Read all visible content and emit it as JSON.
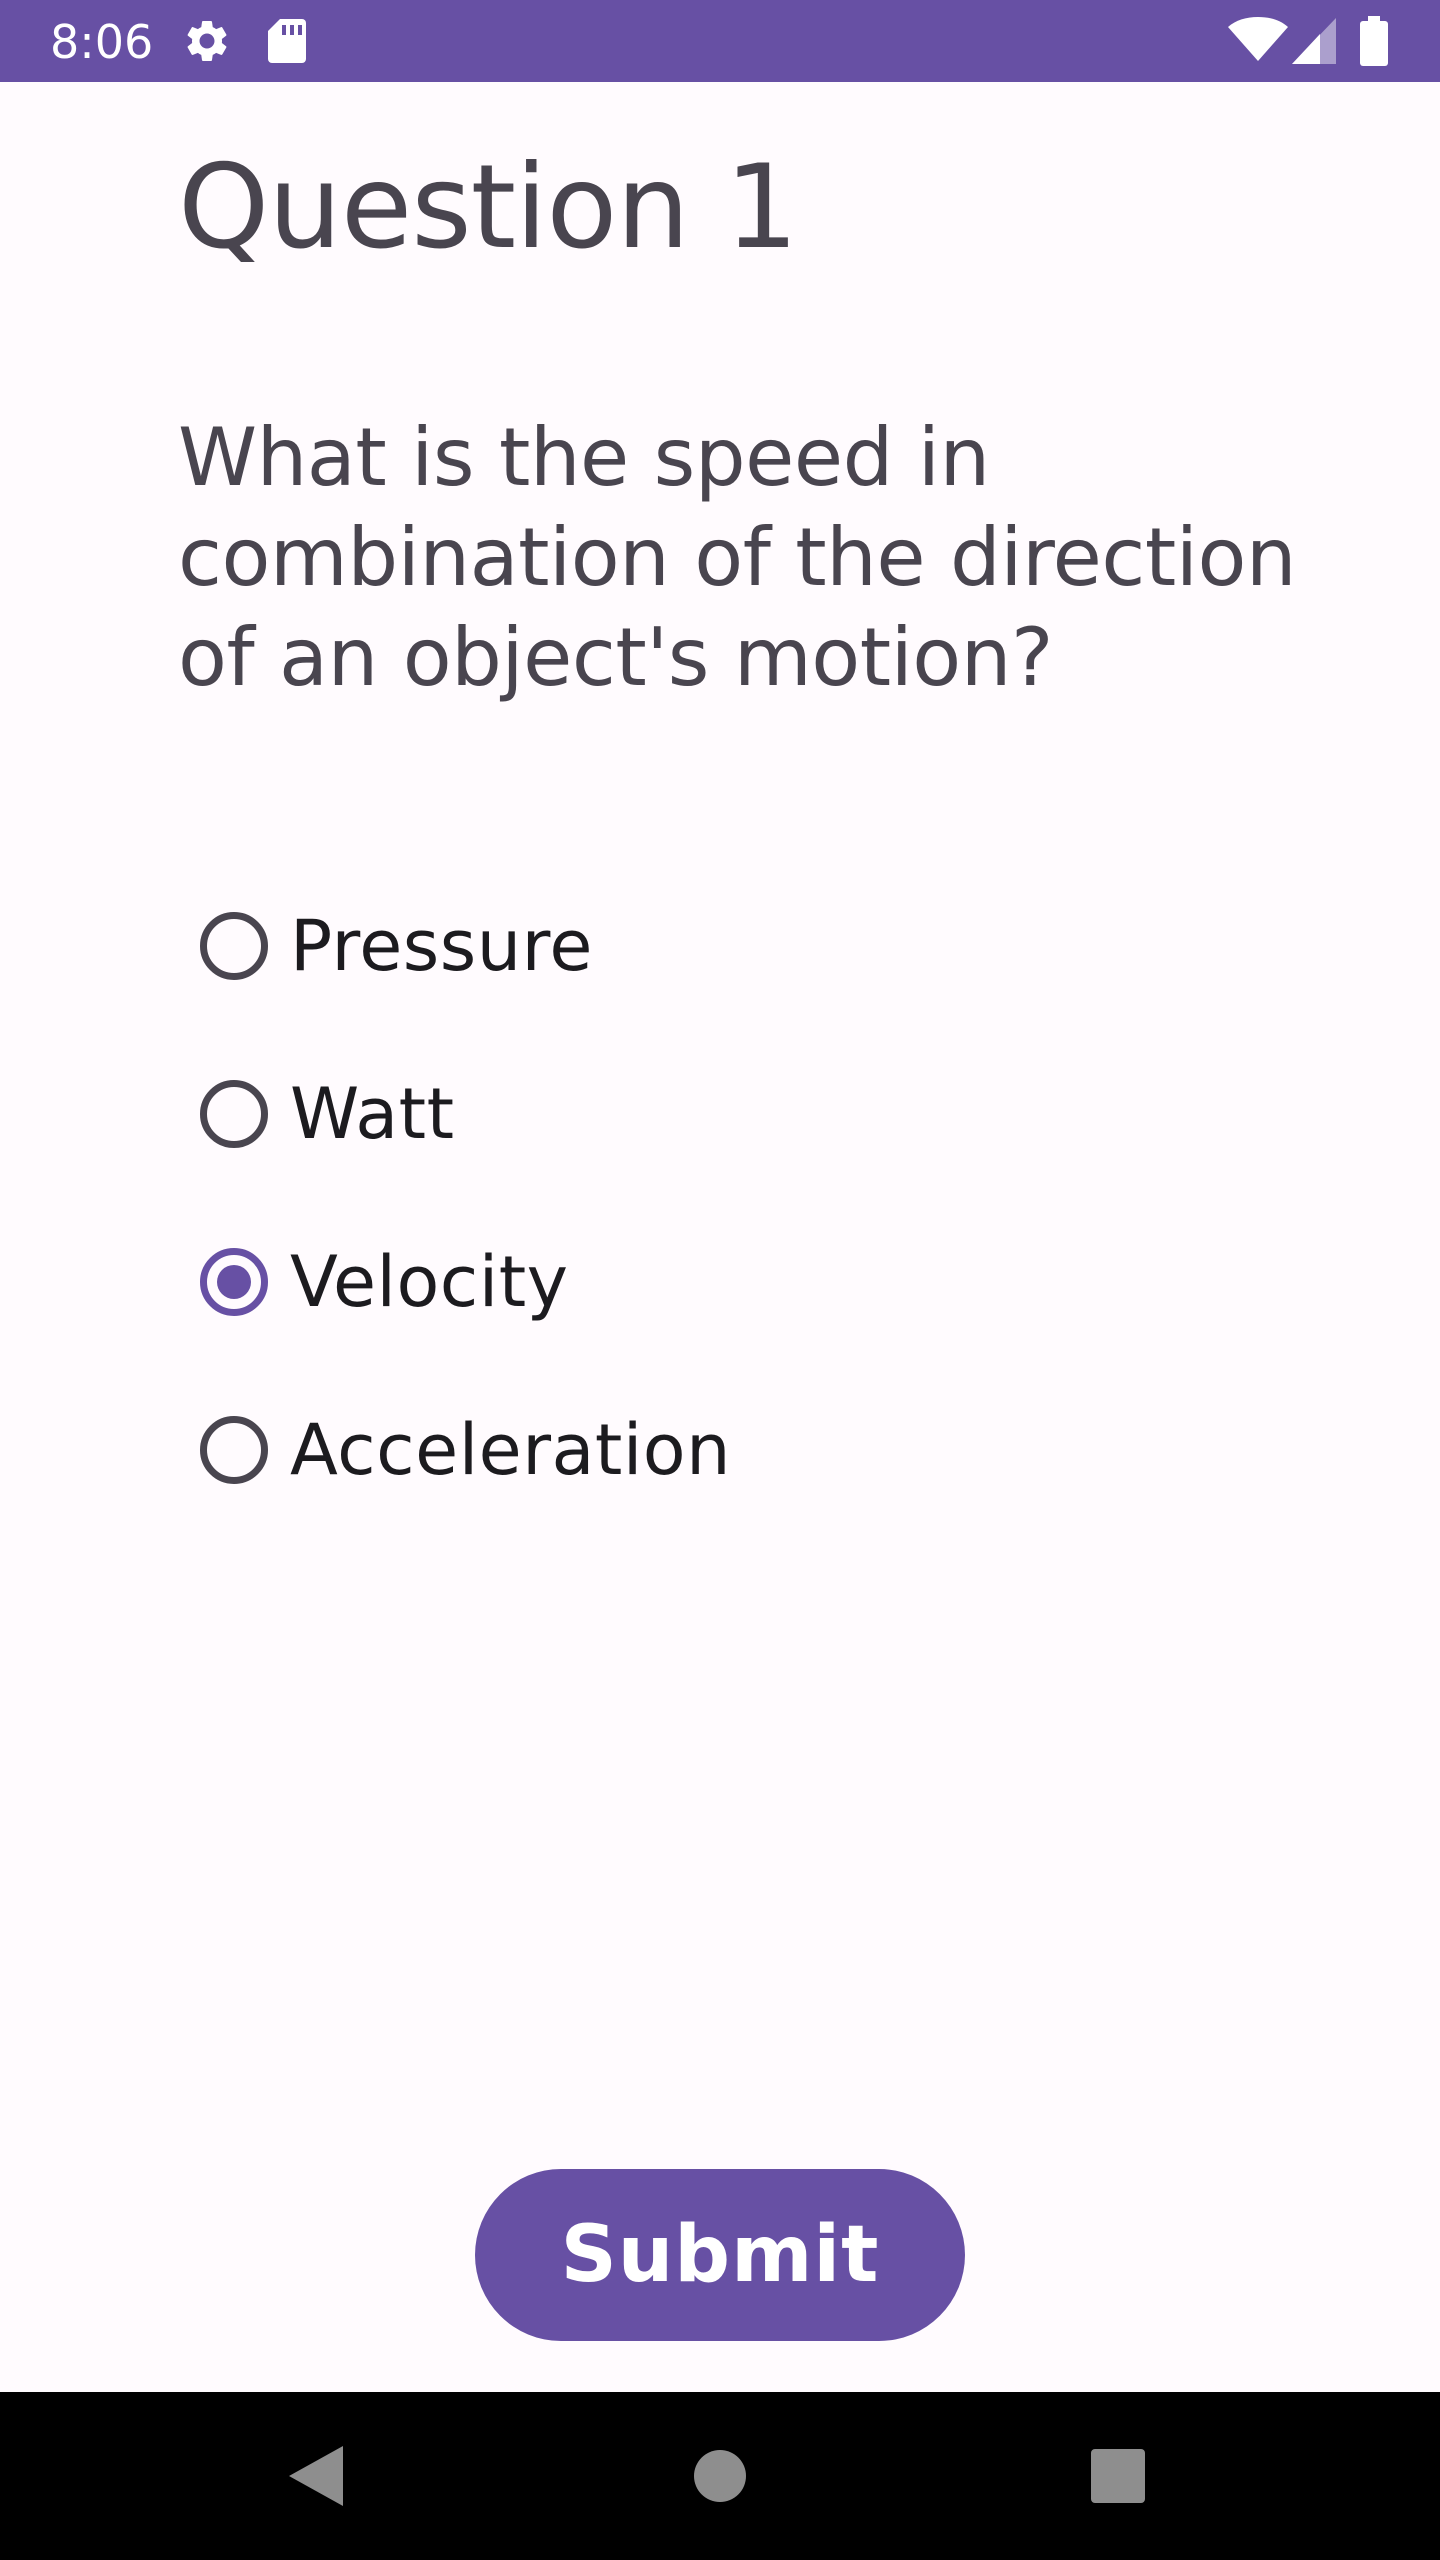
{
  "status_bar": {
    "time": "8:06",
    "icons": [
      "gear-icon",
      "sd-card-icon",
      "wifi-icon",
      "cell-signal-icon",
      "battery-icon"
    ],
    "background": "#6750a4"
  },
  "quiz": {
    "title": "Question 1",
    "question": "What is the speed in combination of the direction of an object's motion?",
    "options": [
      {
        "label": "Pressure",
        "selected": false
      },
      {
        "label": "Watt",
        "selected": false
      },
      {
        "label": "Velocity",
        "selected": true
      },
      {
        "label": "Acceleration",
        "selected": false
      }
    ],
    "submit_label": "Submit"
  },
  "navigation_bar": {
    "icons": [
      "back-icon",
      "home-icon",
      "recents-icon"
    ]
  },
  "colors": {
    "accent": "#6750a4",
    "background": "#fffbfe",
    "text_secondary": "#49454f",
    "text_primary": "#1c1b1f"
  }
}
